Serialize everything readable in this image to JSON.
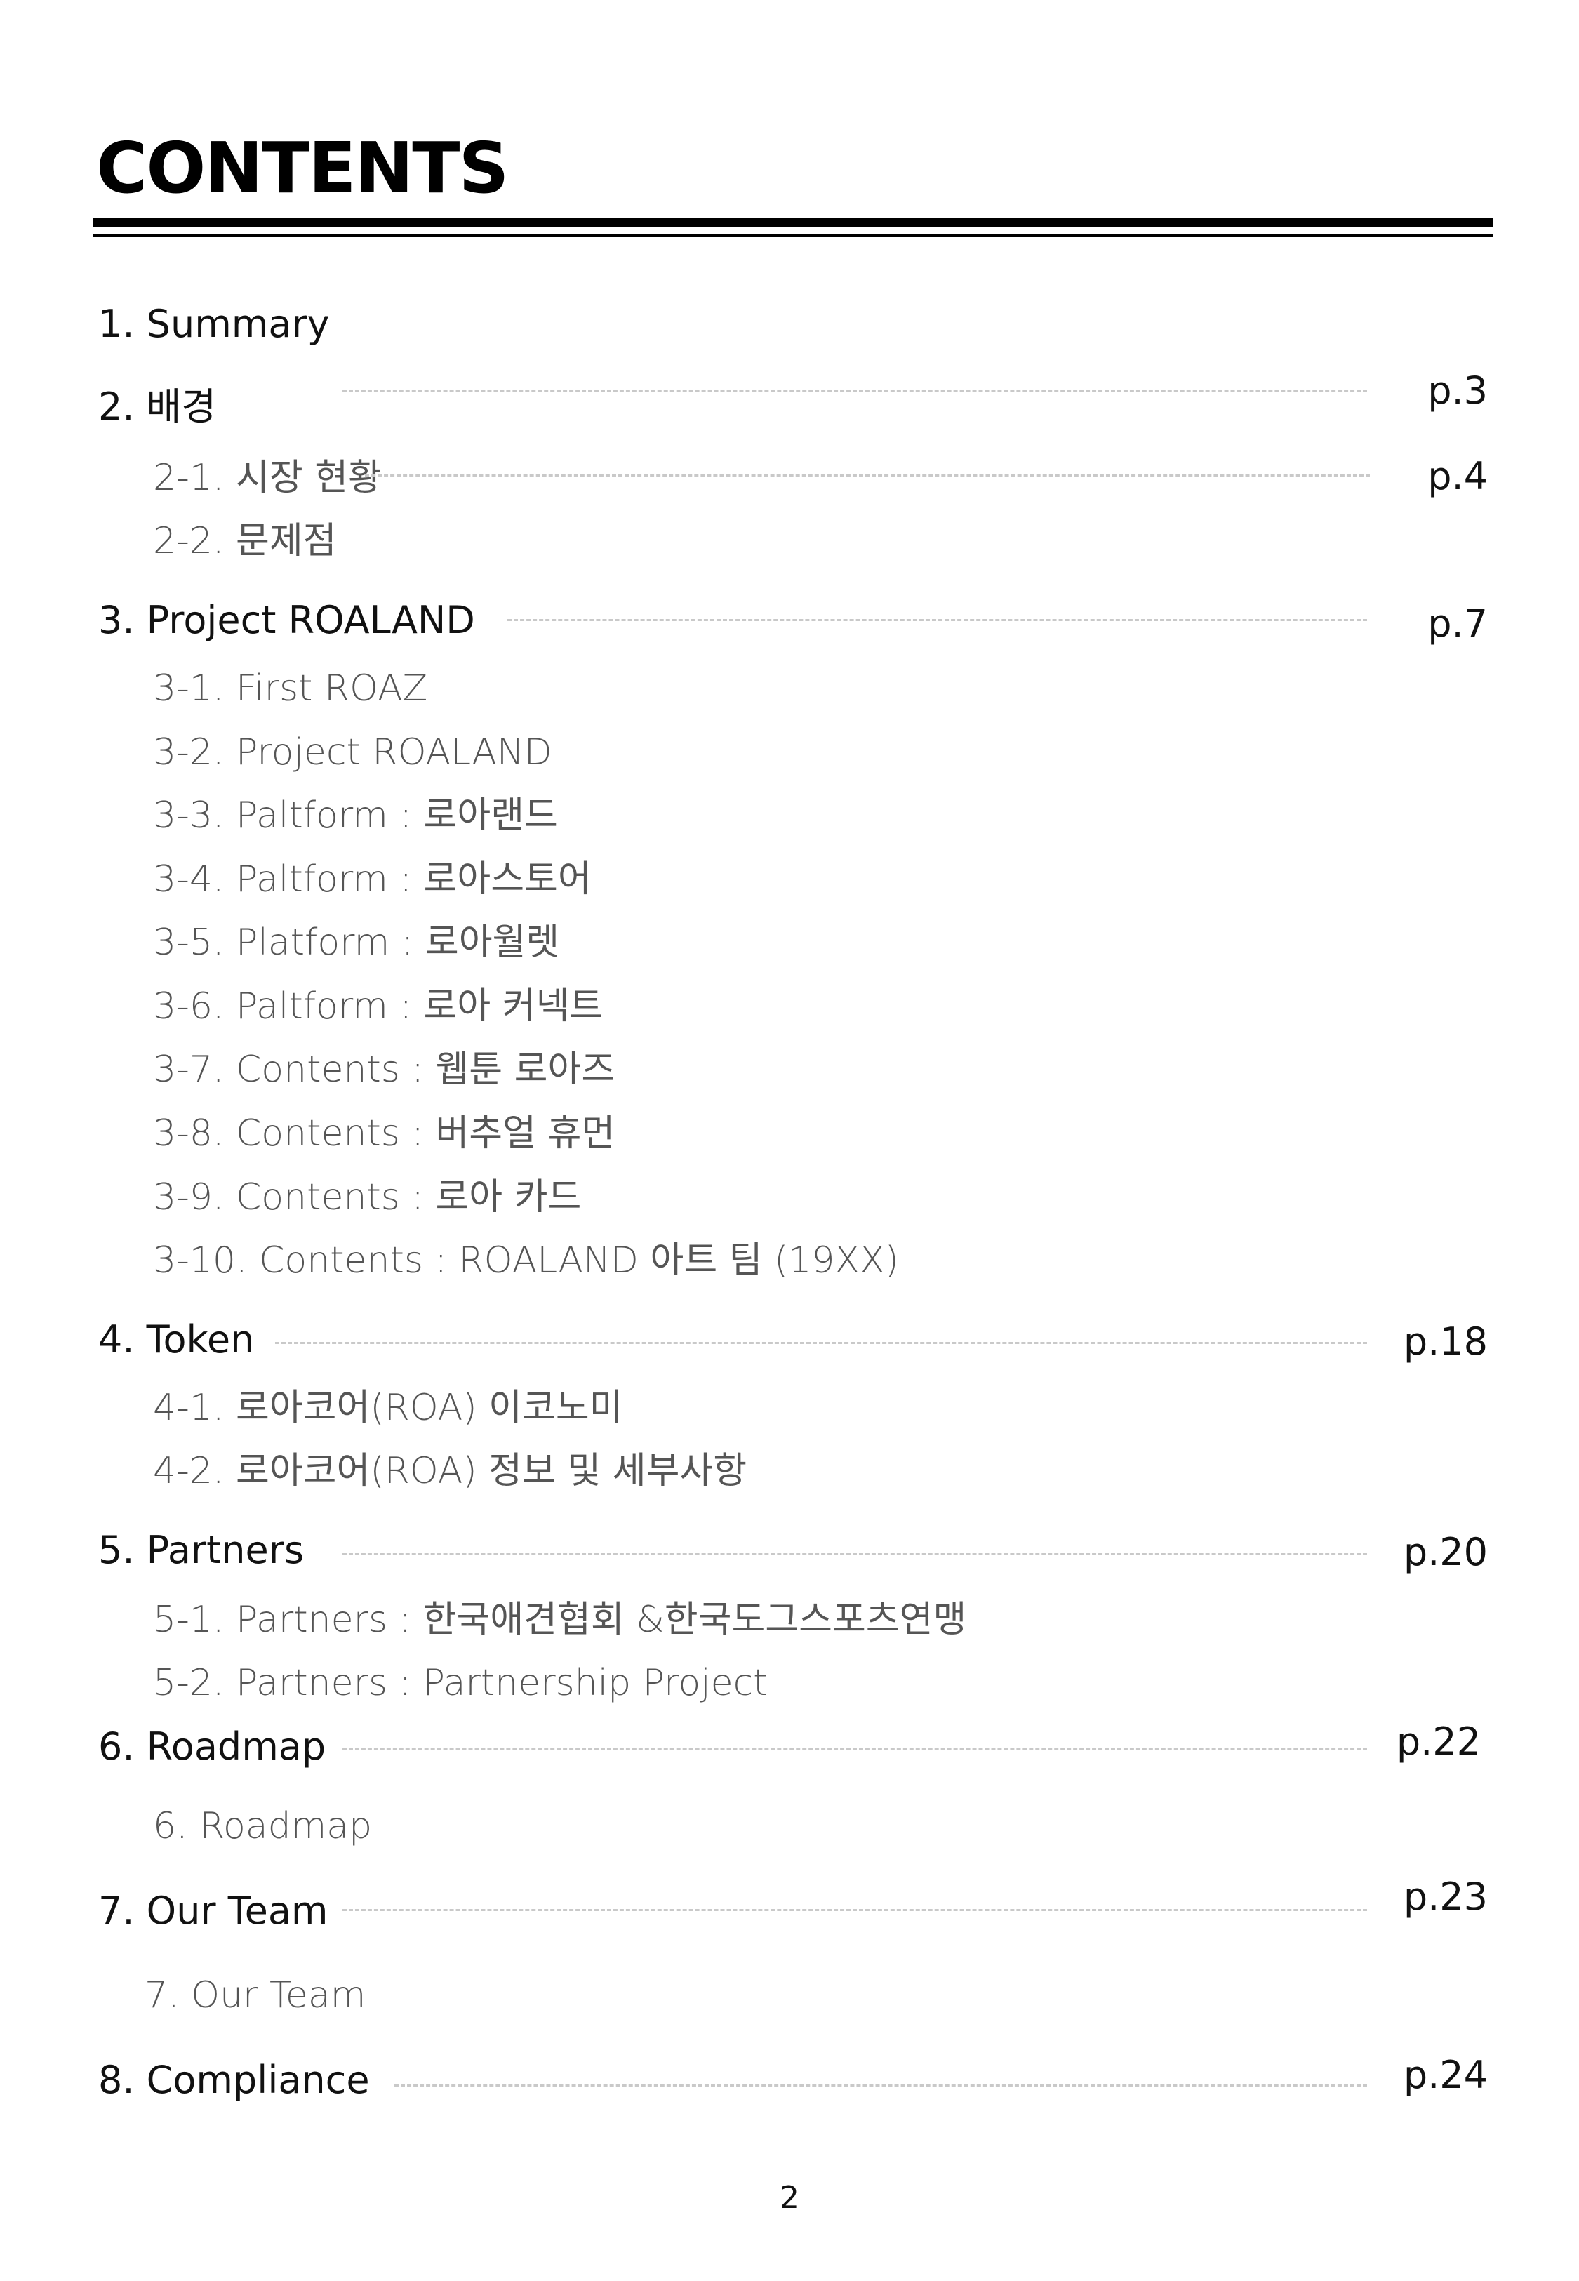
{
  "title": "CONTENTS",
  "sections": [
    {
      "label": "1. Summary"
    },
    {
      "label": "2. 배경",
      "page": "p.3"
    },
    {
      "label": "2-1. 시장 현황",
      "page": "p.4"
    },
    {
      "label": "2-2.  문제점"
    },
    {
      "label": "3. Project ROALAND",
      "page": "p.7"
    },
    {
      "label": "3-1. First ROAZ"
    },
    {
      "label": "3-2. Project ROALAND"
    },
    {
      "label": "3-3. Paltform :  로아랜드"
    },
    {
      "label": "3-4. Paltform :  로아스토어"
    },
    {
      "label": "3-5. Platform :  로아월렛"
    },
    {
      "label": "3-6. Paltform :  로아 커넥트"
    },
    {
      "label": "3-7. Contents : 웹툰 로아즈"
    },
    {
      "label": "3-8. Contents : 버추얼 휴먼"
    },
    {
      "label": "3-9. Contents : 로아 카드"
    },
    {
      "label": "3-10. Contents : ROALAND 아트 팀 (19XX)"
    },
    {
      "label": "4. Token",
      "page": "p.18"
    },
    {
      "label": "4-1.  로아코어(ROA) 이코노미"
    },
    {
      "label": "4-2. 로아코어(ROA) 정보 및 세부사항"
    },
    {
      "label": "5. Partners",
      "page": "p.20"
    },
    {
      "label": "5-1.  Partners :  한국애견협회 &한국도그스포츠연맹"
    },
    {
      "label": "5-2.  Partners : Partnership Project"
    },
    {
      "label": "6. Roadmap",
      "page": "p.22"
    },
    {
      "label": "6. Roadmap"
    },
    {
      "label": "7. Our Team",
      "page": "p.23"
    },
    {
      "label": "7. Our Team"
    },
    {
      "label": "8. Compliance",
      "page": "p.24"
    }
  ],
  "page_number": "2"
}
